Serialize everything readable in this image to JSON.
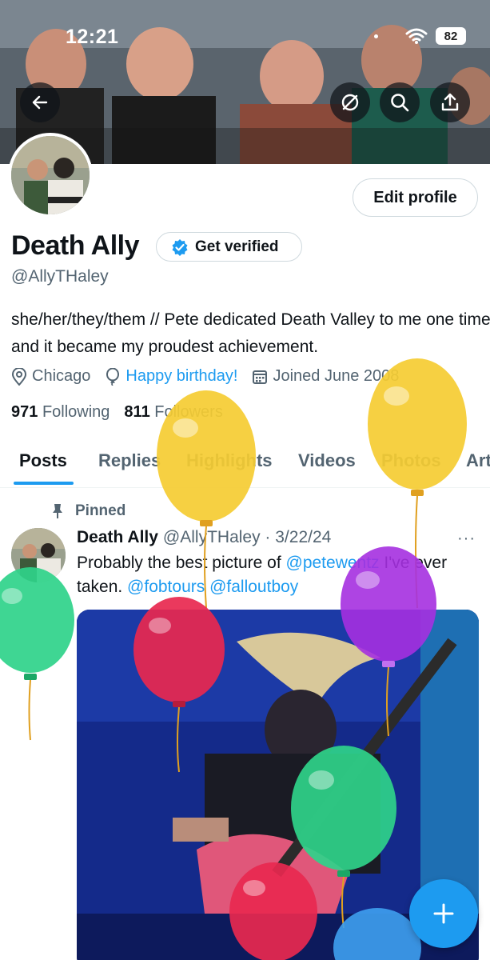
{
  "status_bar": {
    "time": "12:21",
    "battery": "82"
  },
  "profile": {
    "name": "Death Ally",
    "get_verified_label": "Get verified",
    "handle": "@AllyTHaley",
    "bio": "she/her/they/them // Pete dedicated Death Valley to me one time and it became my proudest achievement.",
    "location": "Chicago",
    "birthday": "Happy birthday!",
    "joined": "Joined June 2008",
    "following_count": "971",
    "following_label": "Following",
    "followers_count": "811",
    "followers_label": "Followers",
    "edit_profile_label": "Edit profile"
  },
  "tabs": [
    {
      "label": "Posts"
    },
    {
      "label": "Replies"
    },
    {
      "label": "Highlights"
    },
    {
      "label": "Videos"
    },
    {
      "label": "Photos"
    },
    {
      "label": "Art"
    }
  ],
  "pinned_post": {
    "pinned_label": "Pinned",
    "author": "Death Ally",
    "handle_date": "@AllyTHaley · 3/22/24",
    "text_prefix": "Probably the best picture of ",
    "mention1": "@petewentz",
    "text_mid": " I've ever taken. ",
    "mention2": "@fobtours",
    "mention3": "@falloutboy",
    "more": "···"
  },
  "colors": {
    "accent": "#1d9bf0",
    "balloon_yellow": "#f5cc32",
    "balloon_purple": "#a530e0",
    "balloon_red": "#e8284f",
    "balloon_green": "#2fd38a",
    "balloon_blue": "#3ea0f0"
  },
  "icons": [
    "back-arrow-icon",
    "mute-icon",
    "search-icon",
    "share-icon",
    "verified-check-icon",
    "location-icon",
    "balloon-icon",
    "calendar-icon",
    "pin-icon",
    "plus-icon"
  ]
}
